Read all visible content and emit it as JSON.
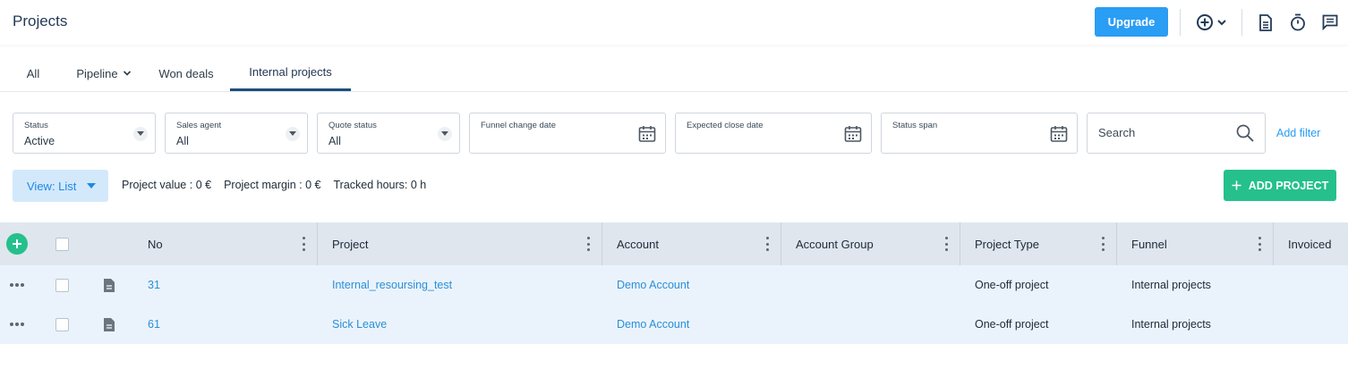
{
  "header": {
    "title": "Projects",
    "upgrade_label": "Upgrade",
    "icons": [
      "add-circle-icon",
      "chevron-down-icon",
      "document-icon",
      "stopwatch-icon",
      "chat-icon"
    ]
  },
  "tabs": [
    {
      "label": "All"
    },
    {
      "label": "Pipeline"
    },
    {
      "label": "Won deals"
    },
    {
      "label": "Internal projects",
      "active": true
    }
  ],
  "filters": {
    "status": {
      "label": "Status",
      "value": "Active"
    },
    "sales_agent": {
      "label": "Sales agent",
      "value": "All"
    },
    "quote_status": {
      "label": "Quote status",
      "value": "All"
    },
    "funnel_change_date": {
      "label": "Funnel change date"
    },
    "expected_close_date": {
      "label": "Expected close date"
    },
    "status_span": {
      "label": "Status span"
    },
    "search_placeholder": "Search",
    "add_filter": "Add filter"
  },
  "toolbar": {
    "view_label": "View: List",
    "project_value_label": "Project value : ",
    "project_value": "0 €",
    "project_margin_label": "Project margin : ",
    "project_margin": "0 €",
    "tracked_hours_label": "Tracked hours: ",
    "tracked_hours": "0 h",
    "add_project_label": "ADD PROJECT"
  },
  "table": {
    "columns": [
      "No",
      "Project",
      "Account",
      "Account Group",
      "Project Type",
      "Funnel",
      "Invoiced"
    ],
    "rows": [
      {
        "no": "31",
        "project": "Internal_resoursing_test",
        "account": "Demo Account",
        "account_group": "",
        "project_type": "One-off project",
        "funnel": "Internal projects",
        "invoiced": ""
      },
      {
        "no": "61",
        "project": "Sick Leave",
        "account": "Demo Account",
        "account_group": "",
        "project_type": "One-off project",
        "funnel": "Internal projects",
        "invoiced": ""
      }
    ]
  },
  "colors": {
    "accent_blue": "#2a9df4",
    "accent_green": "#25c08c",
    "header_row_bg": "#dfe6ee",
    "row_bg": "#eaf3fc"
  }
}
